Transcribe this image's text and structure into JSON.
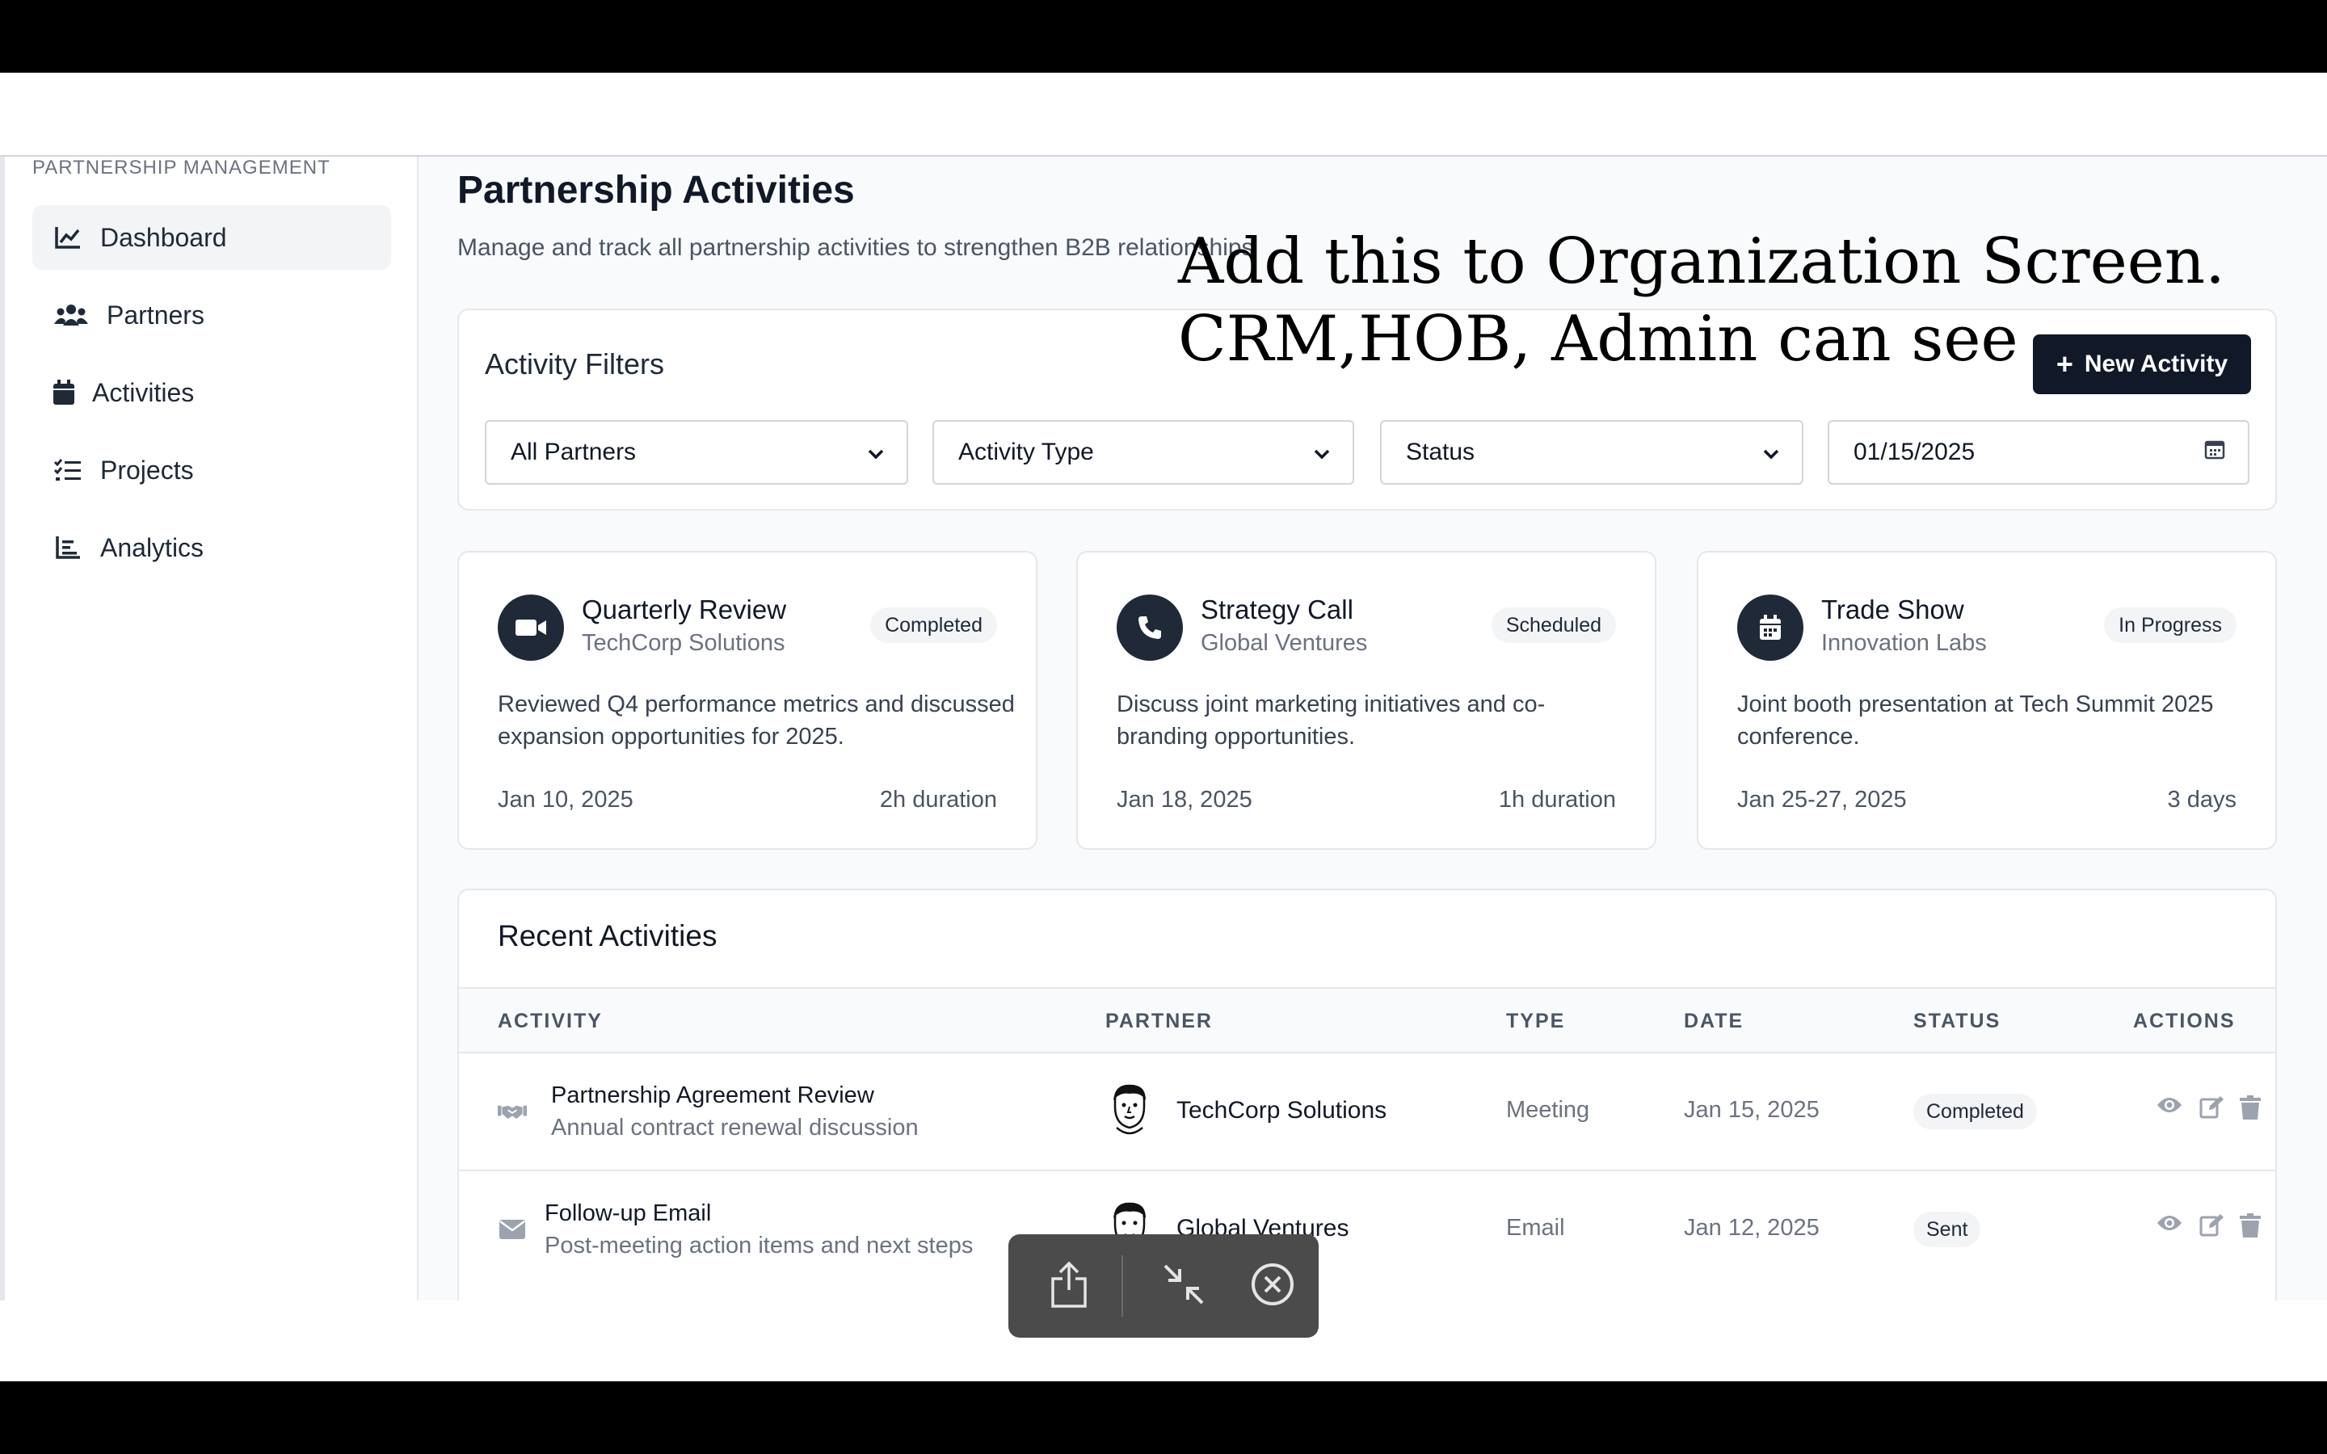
{
  "sidebar": {
    "heading": "PARTNERSHIP MANAGEMENT",
    "items": [
      {
        "label": "Dashboard",
        "icon": "chart-line-icon",
        "active": true
      },
      {
        "label": "Partners",
        "icon": "users-icon"
      },
      {
        "label": "Activities",
        "icon": "calendar-icon"
      },
      {
        "label": "Projects",
        "icon": "list-check-icon"
      },
      {
        "label": "Analytics",
        "icon": "chart-bar-icon"
      }
    ]
  },
  "header": {
    "title": "Partnership Activities",
    "subtitle": "Manage and track all partnership activities to strengthen B2B relationships"
  },
  "filters": {
    "title": "Activity Filters",
    "new_button": "New Activity",
    "partners_select": "All Partners",
    "type_select": "Activity Type",
    "status_select": "Status",
    "date_value": "01/15/2025"
  },
  "activity_cards": [
    {
      "title": "Quarterly Review",
      "partner": "TechCorp Solutions",
      "status": "Completed",
      "icon": "video-icon",
      "description": "Reviewed Q4 performance metrics and discussed expansion opportunities for 2025.",
      "date": "Jan 10, 2025",
      "duration": "2h duration"
    },
    {
      "title": "Strategy Call",
      "partner": "Global Ventures",
      "status": "Scheduled",
      "icon": "phone-icon",
      "description": "Discuss joint marketing initiatives and co-branding opportunities.",
      "date": "Jan 18, 2025",
      "duration": "1h duration"
    },
    {
      "title": "Trade Show",
      "partner": "Innovation Labs",
      "status": "In Progress",
      "icon": "calendar-icon",
      "description": "Joint booth presentation at Tech Summit 2025 conference.",
      "date": "Jan 25-27, 2025",
      "duration": "3 days"
    }
  ],
  "recent": {
    "title": "Recent Activities",
    "columns": [
      "ACTIVITY",
      "PARTNER",
      "TYPE",
      "DATE",
      "STATUS",
      "ACTIONS"
    ],
    "rows": [
      {
        "icon": "handshake-icon",
        "title": "Partnership Agreement Review",
        "subtitle": "Annual contract renewal discussion",
        "partner": "TechCorp Solutions",
        "type": "Meeting",
        "date": "Jan 15, 2025",
        "status": "Completed"
      },
      {
        "icon": "envelope-icon",
        "title": "Follow-up Email",
        "subtitle": "Post-meeting action items and next steps",
        "partner": "Global Ventures",
        "type": "Email",
        "date": "Jan 12, 2025",
        "status": "Sent"
      }
    ]
  },
  "annotation": {
    "line1": "Add this to Organization Screen.",
    "line2": "CRM,HOB, Admin can see"
  },
  "colors": {
    "primary": "#111827",
    "muted": "#6b7280",
    "badge_bg": "#f3f4f6",
    "toolbar_bg": "#4b4b4b"
  }
}
